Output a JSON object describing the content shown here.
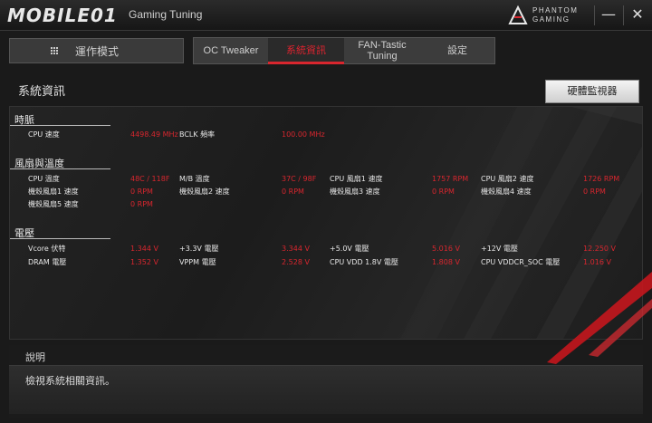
{
  "titlebar": {
    "site_logo": "MOBILE01",
    "app_title": "Gaming Tuning",
    "brand_line1": "PHANTOM",
    "brand_line2": "GAMING",
    "minimize_icon": "minimize-icon",
    "close_icon": "close-icon"
  },
  "mode": {
    "label": "運作模式",
    "icon": "grid-icon"
  },
  "tabs": [
    {
      "label": "OC Tweaker",
      "active": false
    },
    {
      "label": "系統資訊",
      "active": true
    },
    {
      "label_line1": "FAN-Tastic",
      "label_line2": "Tuning",
      "active": false
    },
    {
      "label": "設定",
      "active": false
    }
  ],
  "page": {
    "title": "系統資訊",
    "hw_monitor_button": "硬體監視器"
  },
  "clock": {
    "title": "時脈",
    "cpu_speed_label": "CPU 速度",
    "cpu_speed_value": "4498.49 MHz",
    "bclk_label": "BCLK 頻率",
    "bclk_value": "100.00 MHz"
  },
  "fan": {
    "title": "風扇與溫度",
    "rows": [
      [
        {
          "label": "CPU 溫度",
          "value": "48C / 118F"
        },
        {
          "label": "M/B 溫度",
          "value": "37C / 98F"
        },
        {
          "label": "CPU 風扇1 速度",
          "value": "1757 RPM"
        },
        {
          "label": "CPU 風扇2 速度",
          "value": "1726 RPM"
        }
      ],
      [
        {
          "label": "機殼風扇1 速度",
          "value": "0 RPM"
        },
        {
          "label": "機殼風扇2 速度",
          "value": "0 RPM"
        },
        {
          "label": "機殼風扇3 速度",
          "value": "0 RPM"
        },
        {
          "label": "機殼風扇4 速度",
          "value": "0 RPM"
        }
      ],
      [
        {
          "label": "機殼風扇5 速度",
          "value": "0 RPM"
        }
      ]
    ]
  },
  "voltage": {
    "title": "電壓",
    "rows": [
      [
        {
          "label": "Vcore 伏特",
          "value": "1.344 V"
        },
        {
          "label": "+3.3V 電壓",
          "value": "3.344 V"
        },
        {
          "label": "+5.0V 電壓",
          "value": "5.016 V"
        },
        {
          "label": "+12V 電壓",
          "value": "12.250 V"
        }
      ],
      [
        {
          "label": "DRAM 電壓",
          "value": "1.352 V"
        },
        {
          "label": "VPPM 電壓",
          "value": "2.528 V"
        },
        {
          "label": "CPU VDD 1.8V 電壓",
          "value": "1.808 V"
        },
        {
          "label": "CPU VDDCR_SOC 電壓",
          "value": "1.016 V"
        }
      ]
    ]
  },
  "description": {
    "title": "說明",
    "text": "檢視系統相關資訊。"
  },
  "colors": {
    "accent": "#d8262e",
    "text": "#e6e6e6",
    "panel": "#222222"
  }
}
